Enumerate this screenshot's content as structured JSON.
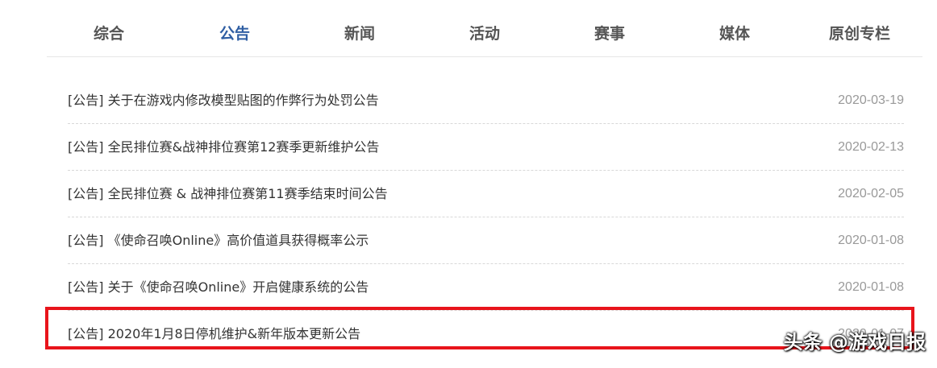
{
  "nav": {
    "tabs": [
      {
        "label": "综合",
        "active": false
      },
      {
        "label": "公告",
        "active": true
      },
      {
        "label": "新闻",
        "active": false
      },
      {
        "label": "活动",
        "active": false
      },
      {
        "label": "赛事",
        "active": false
      },
      {
        "label": "媒体",
        "active": false
      },
      {
        "label": "原创专栏",
        "active": false
      }
    ]
  },
  "announcements": [
    {
      "tag": "[公告]",
      "title": "关于在游戏内修改模型贴图的作弊行为处罚公告",
      "date": "2020-03-19"
    },
    {
      "tag": "[公告]",
      "title": "全民排位赛&战神排位赛第12赛季更新维护公告",
      "date": "2020-02-13"
    },
    {
      "tag": "[公告]",
      "title": "全民排位赛 & 战神排位赛第11赛季结束时间公告",
      "date": "2020-02-05"
    },
    {
      "tag": "[公告]",
      "title": "《使命召唤Online》高价值道具获得概率公示",
      "date": "2020-01-08"
    },
    {
      "tag": "[公告]",
      "title": "关于《使命召唤Online》开启健康系统的公告",
      "date": "2020-01-08"
    },
    {
      "tag": "[公告]",
      "title": "2020年1月8日停机维护&新年版本更新公告",
      "date": "2020-01-07"
    }
  ],
  "watermark": "头条 @游戏日报",
  "colors": {
    "active_tab": "#2f5ea3",
    "highlight_border": "#e8141b",
    "date_text": "#999999"
  }
}
